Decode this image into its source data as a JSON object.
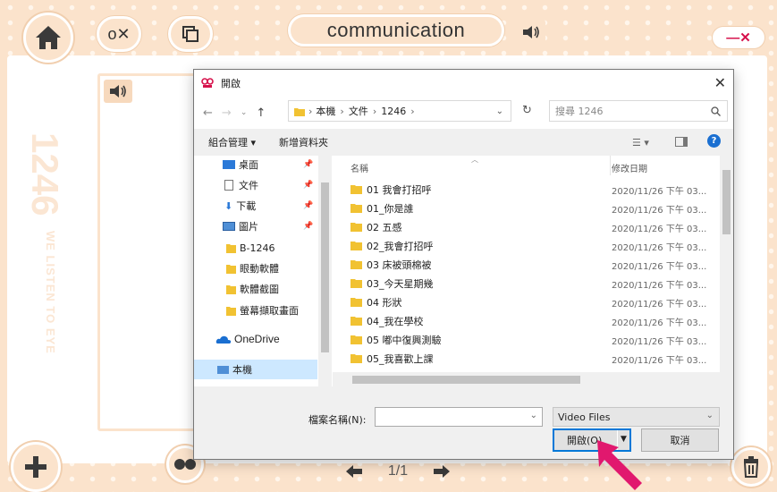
{
  "app": {
    "title": "communication",
    "close_label": "—✕",
    "card_number": "1246",
    "slogan": "WE LISTEN TO EYE",
    "pager": "1/1",
    "colors": {
      "peach": "#fbe3cc",
      "accent_red": "#d6114b",
      "pointer": "#e1186e"
    },
    "icons": [
      "home-icon",
      "ox-icon",
      "copy-icon",
      "speaker-icon",
      "add-icon",
      "eyes-icon",
      "arrow-left-icon",
      "arrow-right-icon",
      "trash-icon"
    ]
  },
  "dialog": {
    "title": "開啟",
    "close_glyph": "✕",
    "breadcrumb": [
      "本機",
      "文件",
      "1246"
    ],
    "search_placeholder": "搜尋 1246",
    "toolbar": {
      "organize": "組合管理 ▾",
      "new_folder": "新增資料夾"
    },
    "nav_items": [
      {
        "label": "桌面",
        "icon": "desktop-icon",
        "pinned": true
      },
      {
        "label": "文件",
        "icon": "document-icon",
        "pinned": true
      },
      {
        "label": "下載",
        "icon": "download-icon",
        "pinned": true
      },
      {
        "label": "圖片",
        "icon": "pictures-icon",
        "pinned": true
      },
      {
        "label": "B-1246",
        "icon": "folder-icon",
        "pinned": false
      },
      {
        "label": "眼動軟體",
        "icon": "folder-icon",
        "pinned": false
      },
      {
        "label": "軟體截圖",
        "icon": "folder-icon",
        "pinned": false
      },
      {
        "label": "螢幕擷取畫面",
        "icon": "folder-icon",
        "pinned": false
      },
      {
        "label": "OneDrive",
        "icon": "onedrive-icon",
        "pinned": false
      },
      {
        "label": "本機",
        "icon": "this-pc-icon",
        "pinned": false
      }
    ],
    "columns": {
      "name": "名稱",
      "date": "修改日期"
    },
    "files": [
      {
        "name": "01 我會打招呼",
        "date": "2020/11/26 下午 03..."
      },
      {
        "name": "01_你是誰",
        "date": "2020/11/26 下午 03..."
      },
      {
        "name": "02 五感",
        "date": "2020/11/26 下午 03..."
      },
      {
        "name": "02_我會打招呼",
        "date": "2020/11/26 下午 03..."
      },
      {
        "name": "03 床被頭棉被",
        "date": "2020/11/26 下午 03..."
      },
      {
        "name": "03_今天星期幾",
        "date": "2020/11/26 下午 03..."
      },
      {
        "name": "04 形狀",
        "date": "2020/11/26 下午 03..."
      },
      {
        "name": "04_我在學校",
        "date": "2020/11/26 下午 03..."
      },
      {
        "name": "05 嘟中復興測驗",
        "date": "2020/11/26 下午 03..."
      },
      {
        "name": "05_我喜歡上課",
        "date": "2020/11/26 下午 03..."
      }
    ],
    "filename_label": "檔案名稱(N):",
    "filename_value": "",
    "filetype": "Video Files",
    "open_label": "開啟(O)",
    "cancel_label": "取消"
  }
}
